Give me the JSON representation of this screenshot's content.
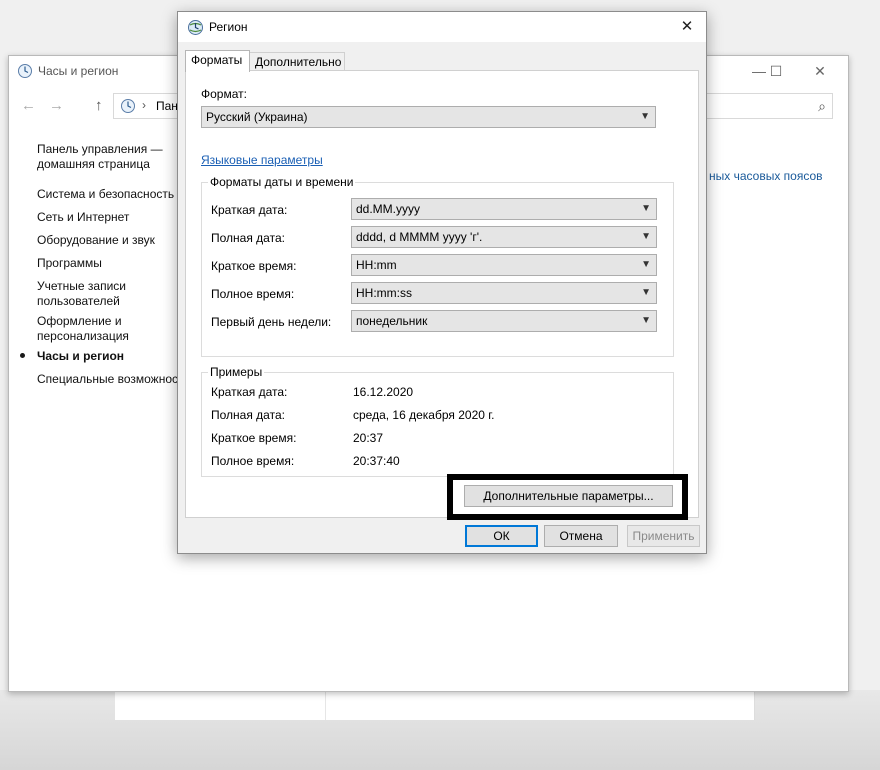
{
  "control_panel": {
    "title": "Часы и регион",
    "address_text": "Панел",
    "right_link": "ных часовых поясов",
    "sidebar": [
      {
        "label": "Панель управления —\nдомашняя страница"
      },
      {
        "label": "Система и безопасность"
      },
      {
        "label": "Сеть и Интернет"
      },
      {
        "label": "Оборудование и звук"
      },
      {
        "label": "Программы"
      },
      {
        "label": "Учетные записи\nпользователей"
      },
      {
        "label": "Оформление и\nперсонализация"
      },
      {
        "label": "Часы и регион",
        "active": true
      },
      {
        "label": "Специальные возможности"
      }
    ],
    "icons": {
      "minimize": "minimize-icon",
      "maximize": "maximize-icon",
      "close": "close-icon",
      "search": "search-icon"
    }
  },
  "dialog": {
    "title": "Регион",
    "tabs": [
      {
        "label": "Форматы",
        "selected": true
      },
      {
        "label": "Дополнительно",
        "selected": false
      }
    ],
    "format_label": "Формат:",
    "format_value": "Русский (Украина)",
    "language_link": "Языковые параметры",
    "date_time_group": {
      "title": "Форматы даты и времени",
      "rows": [
        {
          "label": "Краткая дата:",
          "value": "dd.MM.yyyy"
        },
        {
          "label": "Полная дата:",
          "value": "dddd, d MMMM yyyy 'г'."
        },
        {
          "label": "Краткое время:",
          "value": "HH:mm"
        },
        {
          "label": "Полное время:",
          "value": "HH:mm:ss"
        },
        {
          "label": "Первый день недели:",
          "value": "понедельник"
        }
      ]
    },
    "examples_group": {
      "title": "Примеры",
      "rows": [
        {
          "label": "Краткая дата:",
          "value": "16.12.2020"
        },
        {
          "label": "Полная дата:",
          "value": "среда, 16 декабря 2020 г."
        },
        {
          "label": "Краткое время:",
          "value": "20:37"
        },
        {
          "label": "Полное время:",
          "value": "20:37:40"
        }
      ]
    },
    "additional_button": "Дополнительные параметры...",
    "ok_button": "ОК",
    "cancel_button": "Отмена",
    "apply_button": "Применить"
  },
  "colors": {
    "accent": "#0078d7",
    "link": "#1a5fb4",
    "highlight": "#000000"
  }
}
